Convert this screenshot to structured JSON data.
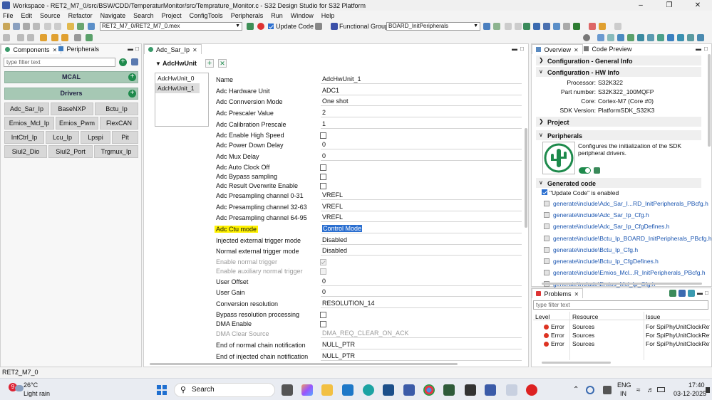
{
  "window": {
    "title": "Workspace - RET2_M7_0/src/BSW/CDD/TemperaturMonitor/src/Temprature_Monitor.c - S32 Design Studio for S32 Platform"
  },
  "menu": [
    "File",
    "Edit",
    "Source",
    "Refactor",
    "Navigate",
    "Search",
    "Project",
    "ConfigTools",
    "Peripherals",
    "Run",
    "Window",
    "Help"
  ],
  "toolbar": {
    "project_combo": "RET2_M7_0/RET2_M7_0.mex",
    "update_code_label": "Update Code",
    "functional_group_label": "Functional Group",
    "functional_group_value": "BOARD_InitPeripherals"
  },
  "components_panel": {
    "tabs": [
      "Components",
      "Peripherals"
    ],
    "filter_placeholder": "type filter text",
    "mcal_label": "MCAL",
    "drivers_label": "Drivers",
    "drivers": [
      [
        "Adc_Sar_Ip",
        "BaseNXP",
        "Bctu_Ip"
      ],
      [
        "Emios_Mcl_Ip",
        "Emios_Pwm",
        "FlexCAN"
      ],
      [
        "IntCtrl_Ip",
        "Lcu_Ip",
        "Lpspi",
        "Pit"
      ],
      [
        "Siul2_Dio",
        "Siul2_Port",
        "Trgmux_Ip"
      ]
    ]
  },
  "editor": {
    "tab_label": "Adc_Sar_Ip",
    "section_title": "AdcHwUnit",
    "units": [
      "AdcHwUnit_0",
      "AdcHwUnit_1"
    ],
    "fields": [
      {
        "label": "Name",
        "value": "AdcHwUnit_1",
        "kind": "text"
      },
      {
        "label": "Adc Hardware Unit",
        "value": "ADC1",
        "kind": "text"
      },
      {
        "label": "Adc Connversion Mode",
        "value": "One shot",
        "kind": "text"
      },
      {
        "label": "Adc Prescaler Value",
        "value": "2",
        "kind": "text"
      },
      {
        "label": "Adc Calibration Prescale",
        "value": "1",
        "kind": "text"
      },
      {
        "label": "Adc Enable High Speed",
        "kind": "check"
      },
      {
        "label": "Adc Power Down Delay",
        "value": "0",
        "kind": "text"
      },
      {
        "label": "Adc Mux Delay",
        "value": "0",
        "kind": "text"
      },
      {
        "label": "Adc Auto Clock Off",
        "kind": "check"
      },
      {
        "label": "Adc Bypass sampling",
        "kind": "check"
      },
      {
        "label": "Adc Result Overwrite Enable",
        "kind": "check"
      },
      {
        "label": "Adc Presampling channel 0-31",
        "value": "VREFL",
        "kind": "text"
      },
      {
        "label": "Adc Presampling channel 32-63",
        "value": "VREFL",
        "kind": "text"
      },
      {
        "label": "Adc Presampling channel 64-95",
        "value": "VREFL",
        "kind": "text"
      },
      {
        "label": "Adc Ctu mode",
        "value": "Control Mode",
        "kind": "text"
      },
      {
        "label": "Injected external trigger mode",
        "value": "Disabled",
        "kind": "text"
      },
      {
        "label": "Normal external trigger mode",
        "value": "Disabled",
        "kind": "text"
      },
      {
        "label": "Enable normal trigger",
        "kind": "check"
      },
      {
        "label": "Enable auxiliary normal trigger",
        "kind": "check"
      },
      {
        "label": "User Offset",
        "value": "0",
        "kind": "text"
      },
      {
        "label": "User Gain",
        "value": "0",
        "kind": "text"
      },
      {
        "label": "Conversion resolution",
        "value": "RESOLUTION_14",
        "kind": "text"
      },
      {
        "label": "Bypass resolution processing",
        "kind": "check"
      },
      {
        "label": "DMA Enable",
        "kind": "check"
      },
      {
        "label": "DMA Clear Source",
        "value": "DMA_REQ_CLEAR_ON_ACK",
        "kind": "text"
      },
      {
        "label": "End of normal chain notification",
        "value": "NULL_PTR",
        "kind": "text"
      },
      {
        "label": "End of injected chain notification",
        "value": "NULL_PTR",
        "kind": "text"
      }
    ]
  },
  "overview": {
    "tabs": [
      "Overview",
      "Code Preview"
    ],
    "general_info": "Configuration - General Info",
    "hw_info": "Configuration - HW Info",
    "hw": [
      {
        "key": "Processor:",
        "value": "S32K322"
      },
      {
        "key": "Part number:",
        "value": "S32K322_100MQFP"
      },
      {
        "key": "Core:",
        "value": "Cortex-M7 (Core #0)"
      },
      {
        "key": "SDK Version:",
        "value": "PlatformSDK_S32K3"
      }
    ],
    "project": "Project",
    "peripherals": "Peripherals",
    "peripherals_desc": "Configures the initialization of the SDK peripheral drivers.",
    "generated_code": "Generated code",
    "update_enabled": "\"Update Code\" is enabled",
    "files": [
      "generate\\include\\Adc_Sar_I...RD_InitPeripherals_PBcfg.h",
      "generate\\include\\Adc_Sar_Ip_Cfg.h",
      "generate\\include\\Adc_Sar_Ip_CfgDefines.h",
      "generate\\include\\Bctu_Ip_BOARD_InitPeripherals_PBcfg.h",
      "generate\\include\\Bctu_Ip_Cfg.h",
      "generate\\include\\Bctu_Ip_CfgDefines.h",
      "generate\\include\\Emios_Mcl...R_InitPeripherals_PBcfg.h",
      "generate\\include\\Emios_Mcl_Ip_Cfg.h"
    ]
  },
  "problems": {
    "tab": "Problems",
    "filter_placeholder": "type filter text",
    "headers": [
      "Level",
      "Resource",
      "Issue"
    ],
    "rows": [
      {
        "level": "Error",
        "resource": "Sources",
        "issue": "For SpiPhyUnitClockRef, cc"
      },
      {
        "level": "Error",
        "resource": "Sources",
        "issue": "For SpiPhyUnitClockRef, cc"
      },
      {
        "level": "Error",
        "resource": "Sources",
        "issue": "For SpiPhyUnitClockRef, cc"
      }
    ]
  },
  "statusbar": {
    "text": "RET2_M7_0"
  },
  "taskbar": {
    "weather_temp": "26°C",
    "weather_desc": "Light rain",
    "weather_badge": "9",
    "search": "Search",
    "lang1": "ENG",
    "lang2": "IN",
    "time": "17:40",
    "date": "03-12-2025"
  },
  "colors": {
    "accent": "#1e8a4c",
    "highlight": "#fff200",
    "selection": "#2b6fd0",
    "error": "#dd3322"
  }
}
